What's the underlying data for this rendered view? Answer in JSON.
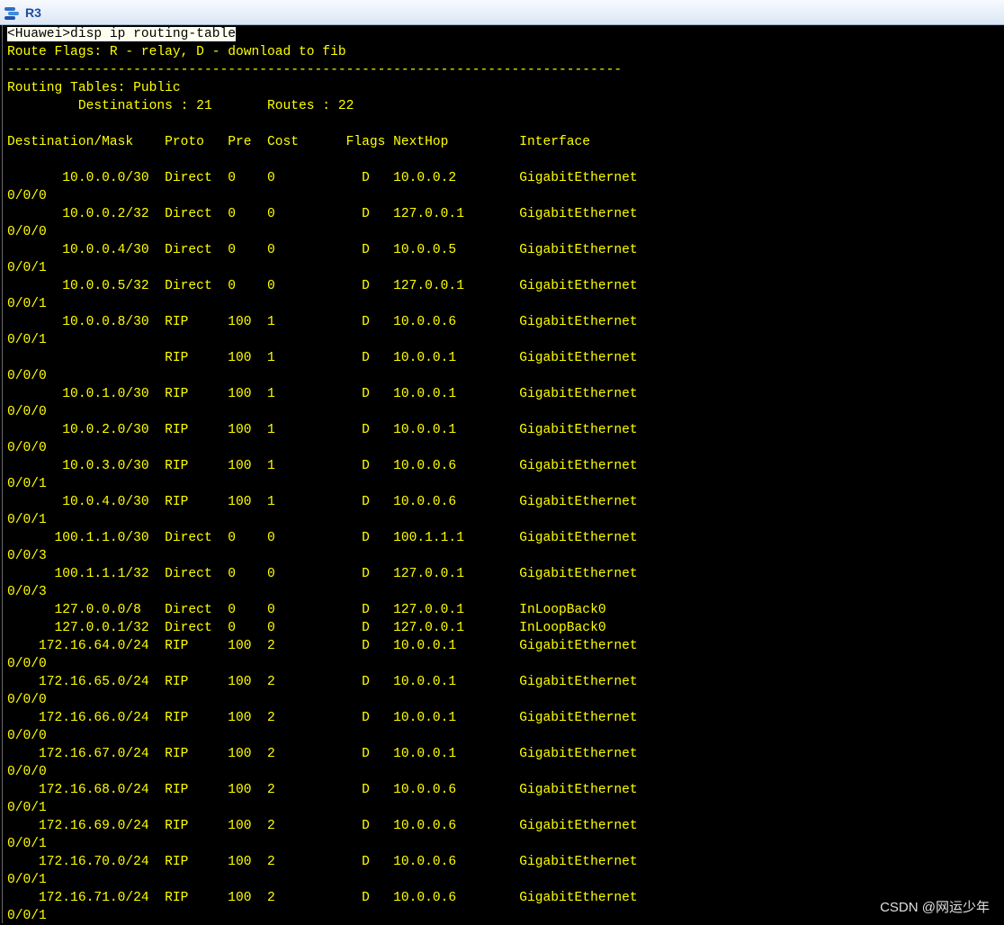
{
  "window": {
    "title": "R3"
  },
  "console": {
    "command_line": "<Huawei>disp ip routing-table",
    "lines": [
      "Route Flags: R - relay, D - download to fib",
      "------------------------------------------------------------------------------",
      "Routing Tables: Public",
      "         Destinations : 21       Routes : 22",
      "",
      "Destination/Mask    Proto   Pre  Cost      Flags NextHop         Interface",
      "",
      "       10.0.0.0/30  Direct  0    0           D   10.0.0.2        GigabitEthernet",
      "0/0/0",
      "       10.0.0.2/32  Direct  0    0           D   127.0.0.1       GigabitEthernet",
      "0/0/0",
      "       10.0.0.4/30  Direct  0    0           D   10.0.0.5        GigabitEthernet",
      "0/0/1",
      "       10.0.0.5/32  Direct  0    0           D   127.0.0.1       GigabitEthernet",
      "0/0/1",
      "       10.0.0.8/30  RIP     100  1           D   10.0.0.6        GigabitEthernet",
      "0/0/1",
      "                    RIP     100  1           D   10.0.0.1        GigabitEthernet",
      "0/0/0",
      "       10.0.1.0/30  RIP     100  1           D   10.0.0.1        GigabitEthernet",
      "0/0/0",
      "       10.0.2.0/30  RIP     100  1           D   10.0.0.1        GigabitEthernet",
      "0/0/0",
      "       10.0.3.0/30  RIP     100  1           D   10.0.0.6        GigabitEthernet",
      "0/0/1",
      "       10.0.4.0/30  RIP     100  1           D   10.0.0.6        GigabitEthernet",
      "0/0/1",
      "      100.1.1.0/30  Direct  0    0           D   100.1.1.1       GigabitEthernet",
      "0/0/3",
      "      100.1.1.1/32  Direct  0    0           D   127.0.0.1       GigabitEthernet",
      "0/0/3",
      "      127.0.0.0/8   Direct  0    0           D   127.0.0.1       InLoopBack0",
      "      127.0.0.1/32  Direct  0    0           D   127.0.0.1       InLoopBack0",
      "    172.16.64.0/24  RIP     100  2           D   10.0.0.1        GigabitEthernet",
      "0/0/0",
      "    172.16.65.0/24  RIP     100  2           D   10.0.0.1        GigabitEthernet",
      "0/0/0",
      "    172.16.66.0/24  RIP     100  2           D   10.0.0.1        GigabitEthernet",
      "0/0/0",
      "    172.16.67.0/24  RIP     100  2           D   10.0.0.1        GigabitEthernet",
      "0/0/0",
      "    172.16.68.0/24  RIP     100  2           D   10.0.0.6        GigabitEthernet",
      "0/0/1",
      "    172.16.69.0/24  RIP     100  2           D   10.0.0.6        GigabitEthernet",
      "0/0/1",
      "    172.16.70.0/24  RIP     100  2           D   10.0.0.6        GigabitEthernet",
      "0/0/1",
      "    172.16.71.0/24  RIP     100  2           D   10.0.0.6        GigabitEthernet",
      "0/0/1"
    ]
  },
  "watermark": "CSDN @网运少年",
  "colors": {
    "text": "#ffff00",
    "background": "#000000",
    "title_text": "#1b4f9c"
  },
  "icons": {
    "app": "router-app-icon"
  }
}
